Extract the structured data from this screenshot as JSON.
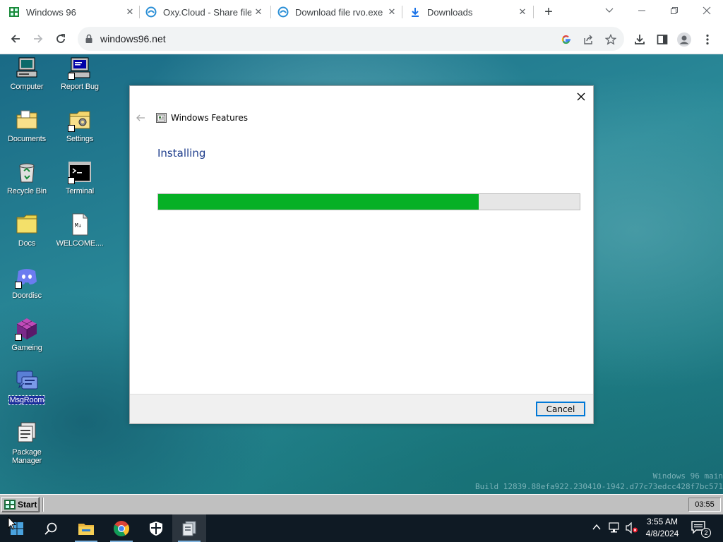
{
  "browser": {
    "tabs": [
      {
        "title": "Windows 96",
        "favicon": "windows96-icon",
        "active": true
      },
      {
        "title": "Oxy.Cloud - Share files",
        "favicon": "oxy-cloud-icon",
        "active": false
      },
      {
        "title": "Download file rvo.exe",
        "favicon": "oxy-cloud-icon",
        "active": false
      },
      {
        "title": "Downloads",
        "favicon": "download-icon",
        "active": false
      }
    ],
    "url": "windows96.net"
  },
  "desktop": {
    "icons": [
      {
        "label": "Computer",
        "icon": "computer-icon"
      },
      {
        "label": "Report Bug",
        "icon": "report-bug-icon"
      },
      {
        "label": "Documents",
        "icon": "documents-folder-icon"
      },
      {
        "label": "Settings",
        "icon": "settings-icon"
      },
      {
        "label": "Recycle Bin",
        "icon": "recycle-bin-icon"
      },
      {
        "label": "Terminal",
        "icon": "terminal-icon"
      },
      {
        "label": "Docs",
        "icon": "folder-icon"
      },
      {
        "label": "WELCOME....",
        "icon": "markdown-file-icon"
      },
      {
        "label": "Doordisc",
        "icon": "doordisc-icon"
      },
      {
        "label": "Gameing",
        "icon": "gameing-icon"
      },
      {
        "label": "MsgRoom",
        "icon": "msgroom-icon",
        "selected": true
      },
      {
        "label": "Package Manager",
        "icon": "package-manager-icon"
      }
    ],
    "watermark": {
      "line1": "Windows 96 main",
      "line2": "Build 12839.88efa922.230410-1942.d77c73edcc428f7bc571"
    }
  },
  "dialog": {
    "title": "Windows Features",
    "heading": "Installing",
    "progress": 0.76,
    "cancel_label": "Cancel",
    "accent_color": "#06b025"
  },
  "win96_taskbar": {
    "start_label": "Start",
    "clock": "03:55"
  },
  "win10_taskbar": {
    "apps": [
      "windows-start-icon",
      "search-icon",
      "file-explorer-icon",
      "chrome-icon",
      "windows-security-icon",
      "app-icon"
    ],
    "time": "3:55 AM",
    "date": "4/8/2024",
    "notification_count": "2"
  }
}
